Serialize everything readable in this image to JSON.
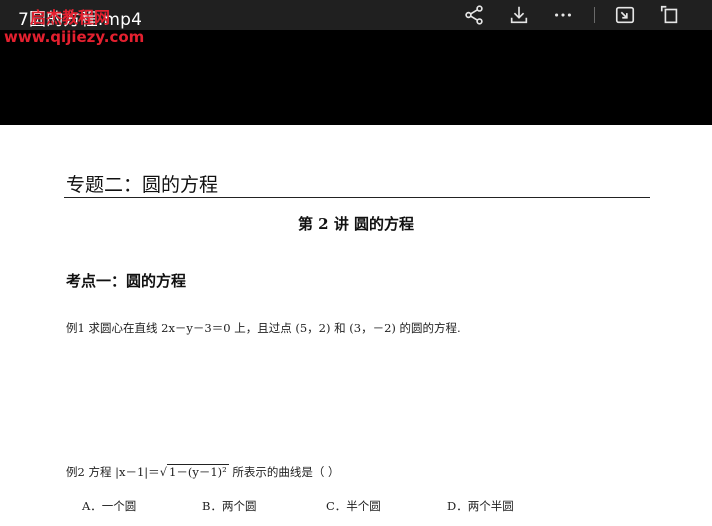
{
  "window": {
    "title": "7圆的方程.mp4"
  },
  "watermark": {
    "site_name": "启杰教程网",
    "url": "www.qijiezy.com"
  },
  "toolbar": {
    "icons": [
      "share-icon",
      "download-icon",
      "more-icon",
      "picture-in-picture-icon",
      "fullscreen-icon"
    ]
  },
  "document": {
    "topic_title": "专题二：圆的方程",
    "lecture_title": "第 2 讲  圆的方程",
    "point_title": "考点一：圆的方程",
    "example1": "例1  求圆心在直线 2x－y－3＝0  上，且过点 (5，2) 和 (3，－2)  的圆的方程.",
    "example2_prefix": "例2  方程 |x－1|＝",
    "example2_sqrt": "1－(y－1)²",
    "example2_suffix": " 所表示的曲线是（        ）",
    "options": [
      {
        "label": "A．一个圆"
      },
      {
        "label": "B．两个圆"
      },
      {
        "label": "C．半个圆"
      },
      {
        "label": "D．两个半圆"
      }
    ]
  },
  "colors": {
    "watermark_red": "#e3202f",
    "topbar_bg": "#202020",
    "page_bg": "#ffffff"
  }
}
